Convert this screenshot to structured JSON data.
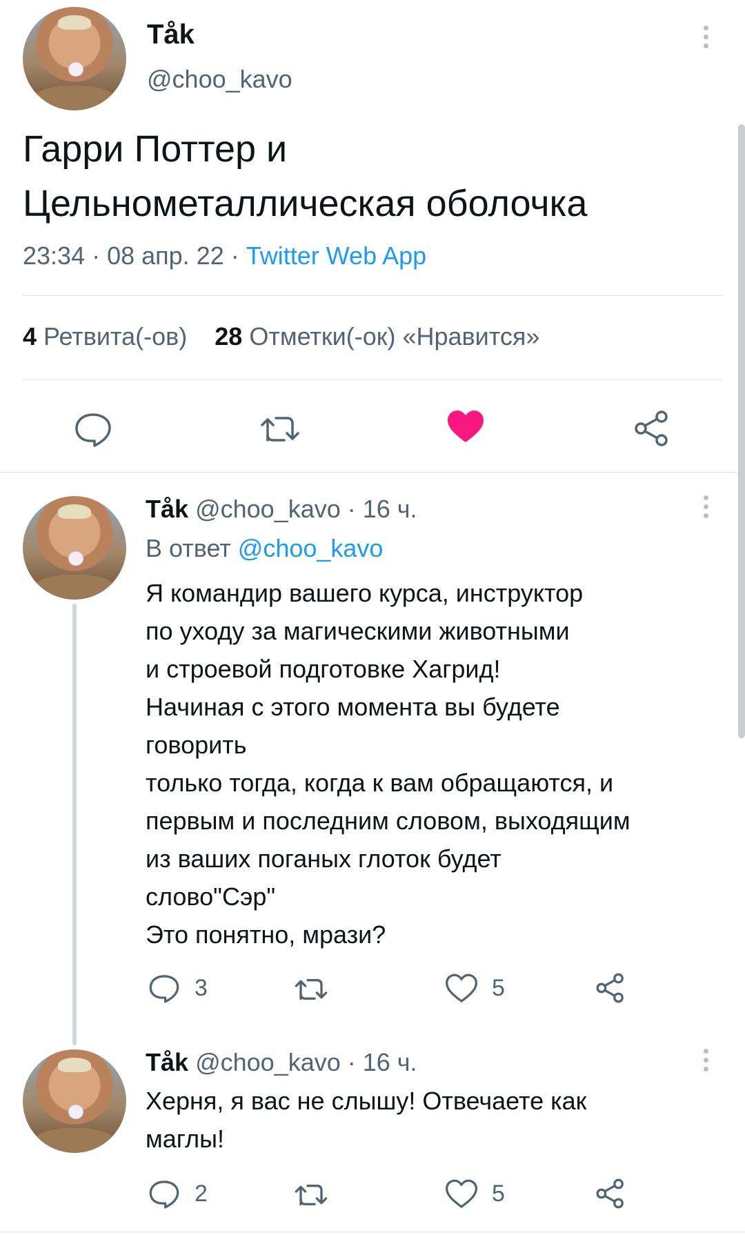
{
  "main_tweet": {
    "display_name": "Tåk",
    "handle": "@choo_kavo",
    "text_line1": "Гарри Поттер и",
    "text_line2": "Цельнометаллическая оболочка",
    "time": "23:34 · 08 апр. 22 · ",
    "source": "Twitter Web App",
    "retweets_count": "4",
    "retweets_label": "Ретвита(-ов)",
    "likes_count": "28",
    "likes_label": "Отметки(-ок) «Нравится»",
    "like_color": "#f91880"
  },
  "reply1": {
    "display_name": "Tåk",
    "meta": "@choo_kavo · 16 ч.",
    "reply_to_prefix": "В ответ ",
    "reply_to_handle": "@choo_kavo",
    "text": "Я командир вашего курса, инструктор\nпо уходу за магическими животными\nи строевой подготовке Хагрид!\nНачиная с этого момента вы будете\nговорить\nтолько тогда, когда к вам обращаются, и\nпервым и последним словом, выходящим\nиз ваших поганых глоток будет\nслово\"Сэр\"\nЭто понятно, мрази?",
    "replies": "3",
    "likes": "5"
  },
  "reply2": {
    "display_name": "Tåk",
    "meta": "@choo_kavo · 16 ч.",
    "text": "Херня, я вас не слышу! Отвечаете как\nмаглы!",
    "replies": "2",
    "likes": "5"
  },
  "icons": {
    "reply": "reply-icon",
    "retweet": "retweet-icon",
    "like": "heart-icon",
    "share": "share-icon",
    "more": "more-icon"
  }
}
